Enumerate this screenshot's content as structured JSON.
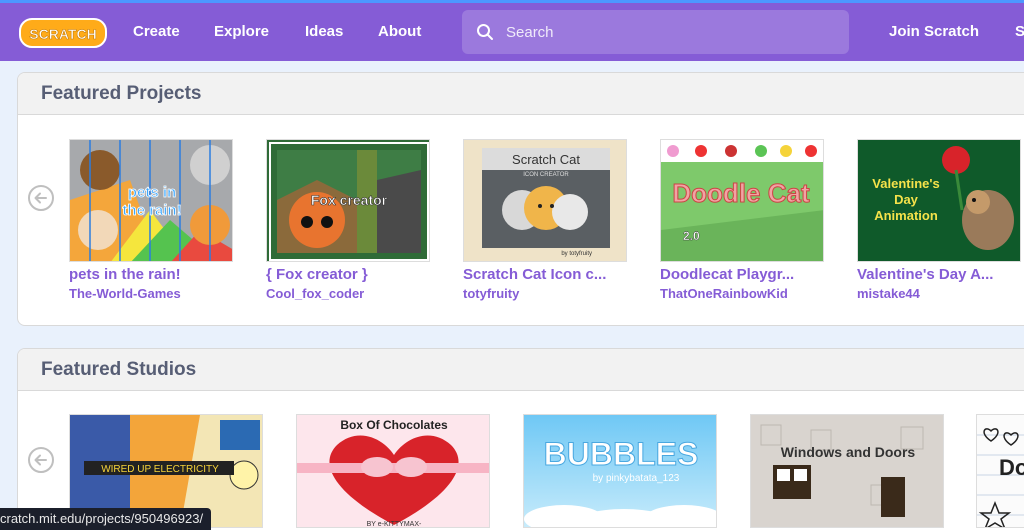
{
  "nav": {
    "logo_text": "SCRATCH",
    "links": [
      "Create",
      "Explore",
      "Ideas",
      "About"
    ],
    "search_placeholder": "Search",
    "join": "Join Scratch",
    "signin_partial": "S"
  },
  "featured_projects": {
    "title": "Featured Projects",
    "items": [
      {
        "title": "pets in the rain!",
        "author": "The-World-Games",
        "thumb_text": "pets in the rain!"
      },
      {
        "title": "{ Fox creator }",
        "author": "Cool_fox_coder",
        "thumb_text": "Fox creator"
      },
      {
        "title": "Scratch Cat Icon c...",
        "author": "totyfruity",
        "thumb_text": "Scratch Cat",
        "thumb_sub": "ICON CREATOR",
        "thumb_credit": "by totyfruity"
      },
      {
        "title": "Doodlecat Playgr...",
        "author": "ThatOneRainbowKid",
        "thumb_text": "Doodle Cat",
        "thumb_sub": "2.0"
      },
      {
        "title": "Valentine's Day A...",
        "author": "mistake44",
        "thumb_text": "Valentine's Day Animation"
      }
    ]
  },
  "featured_studios": {
    "title": "Featured Studios",
    "items": [
      {
        "thumb_text": "WIRED UP ELECTRICITY"
      },
      {
        "thumb_text": "Box Of Chocolates",
        "thumb_credit": "BY e-KITTYMAX-"
      },
      {
        "thumb_text": "BUBBLES",
        "thumb_credit": "by pinkybatata_123"
      },
      {
        "thumb_text": "Windows and Doors"
      },
      {
        "thumb_text": "Do S"
      }
    ]
  },
  "status_url": "cratch.mit.edu/projects/950496923/"
}
